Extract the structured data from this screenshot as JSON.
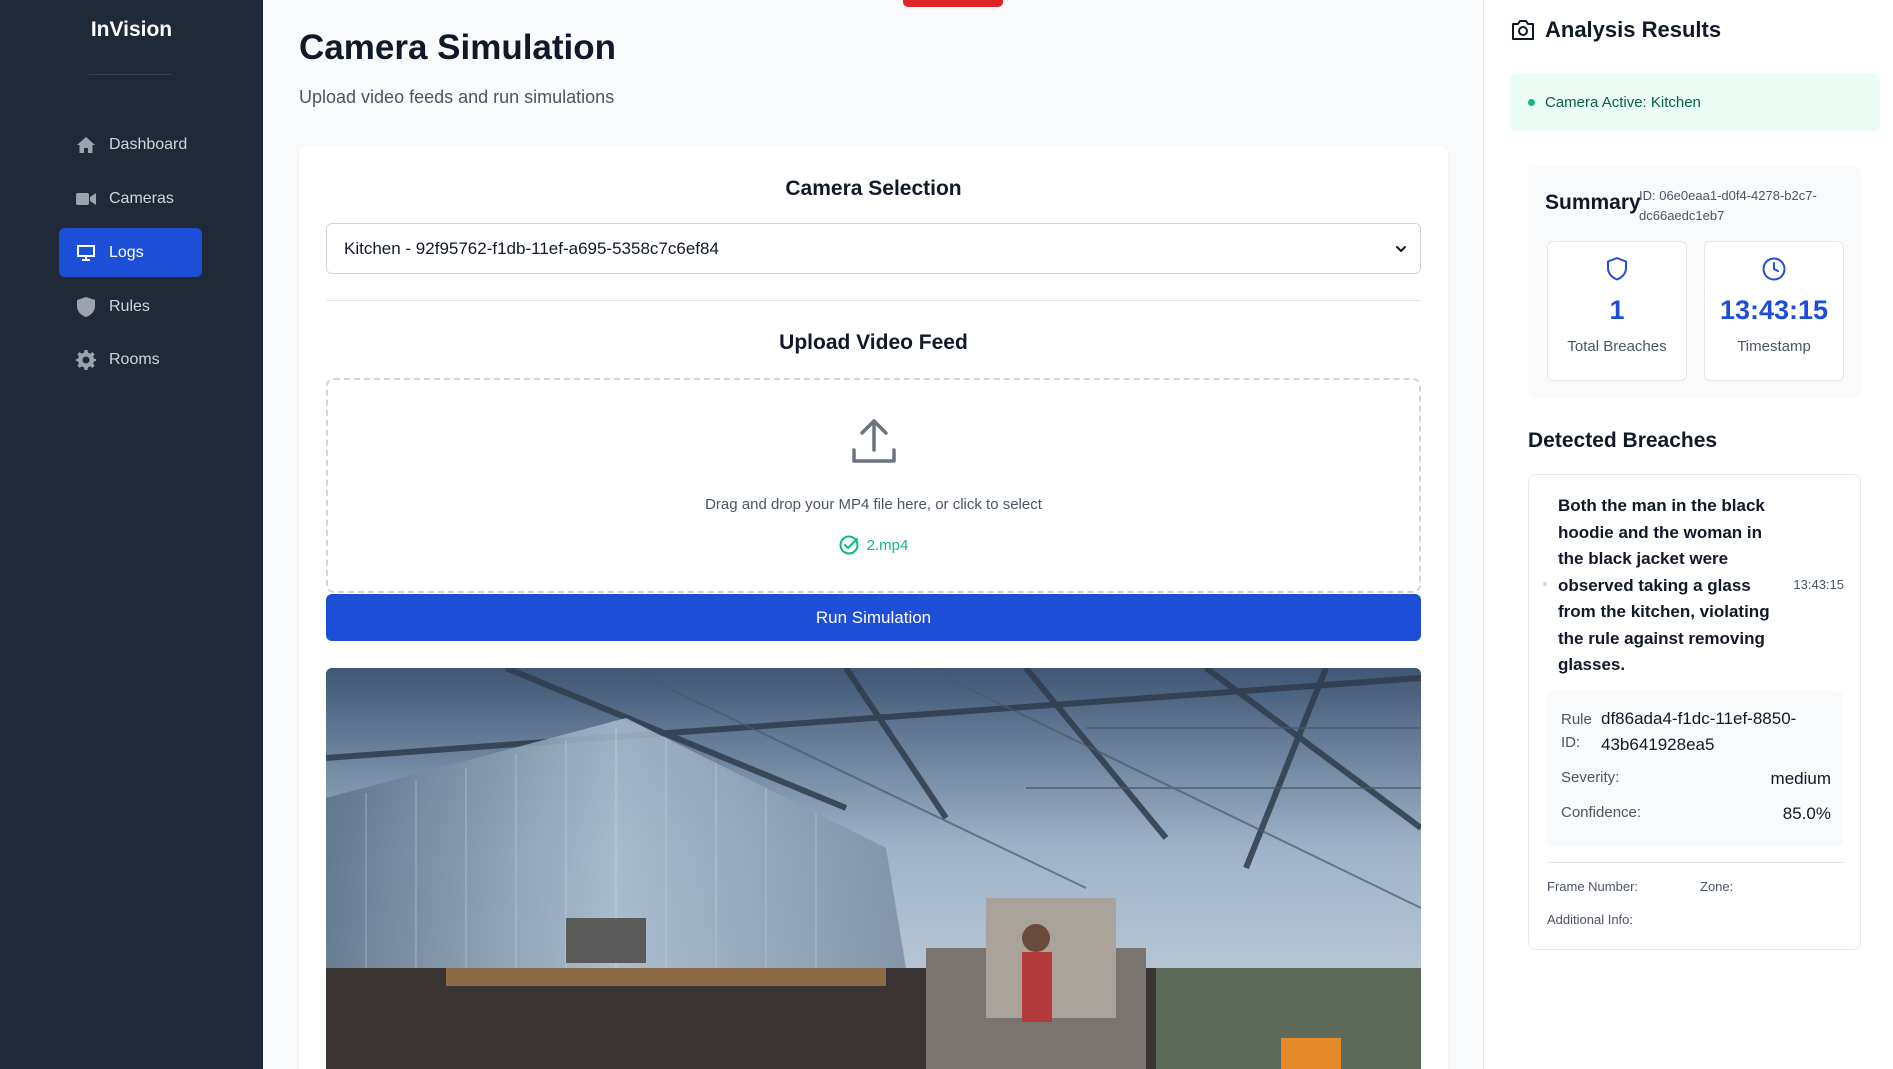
{
  "app": {
    "brand": "InVision"
  },
  "sidebar": {
    "items": [
      {
        "label": "Dashboard",
        "icon": "home-icon",
        "active": false
      },
      {
        "label": "Cameras",
        "icon": "video-camera-icon",
        "active": false
      },
      {
        "label": "Logs",
        "icon": "monitor-icon",
        "active": true
      },
      {
        "label": "Rules",
        "icon": "shield-icon",
        "active": false
      },
      {
        "label": "Rooms",
        "icon": "gear-icon",
        "active": false
      }
    ]
  },
  "main": {
    "title": "Camera Simulation",
    "subtitle": "Upload video feeds and run simulations",
    "camera_selection": {
      "heading": "Camera Selection",
      "selected": "Kitchen - 92f95762-f1db-11ef-a695-5358c7c6ef84"
    },
    "upload": {
      "heading": "Upload Video Feed",
      "instructions": "Drag and drop your MP4 file here, or click to select",
      "file_name": "2.mp4"
    },
    "run_button": "Run Simulation"
  },
  "analysis": {
    "title": "Analysis Results",
    "status": "Camera Active: Kitchen",
    "summary": {
      "title": "Summary",
      "id": "ID: 06e0eaa1-d0f4-4278-b2c7-dc66aedc1eb7",
      "total_breaches_value": "1",
      "total_breaches_label": "Total Breaches",
      "timestamp_value": "13:43:15",
      "timestamp_label": "Timestamp"
    },
    "breaches_title": "Detected Breaches",
    "breach": {
      "description": "Both the man in the black hoodie and the woman in the black jacket were observed taking a glass from the kitchen, violating the rule against removing glasses.",
      "time": "13:43:15",
      "rule_id_label": "Rule ID:",
      "rule_id_value": "df86ada4-f1dc-11ef-8850-43b641928ea5",
      "severity_label": "Severity:",
      "severity_value": "medium",
      "confidence_label": "Confidence:",
      "confidence_value": "85.0%",
      "frame_label": "Frame Number:",
      "zone_label": "Zone:",
      "additional_label": "Additional Info:"
    }
  },
  "colors": {
    "sidebar_bg": "#1f2937",
    "accent": "#1d4ed8",
    "success": "#10b981",
    "alert": "#dc2626"
  }
}
